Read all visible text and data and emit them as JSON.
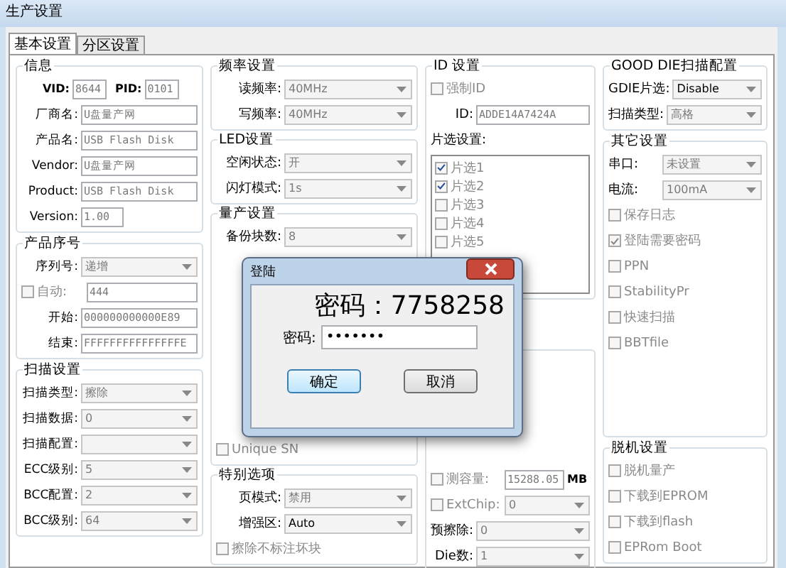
{
  "window": {
    "title": "生产设置"
  },
  "tabs": [
    {
      "label": "基本设置",
      "selected": true
    },
    {
      "label": "分区设置",
      "selected": false
    }
  ],
  "columns": [
    [
      {
        "title": "信息",
        "rows": [
          {
            "kind": "pair",
            "items": [
              {
                "label": "VID:",
                "value": "8644",
                "disabled": true
              },
              {
                "label": "PID:",
                "value": "0101",
                "disabled": true
              }
            ]
          },
          {
            "kind": "field",
            "label": "厂商名:",
            "value": "U盘量产网",
            "disabled": true
          },
          {
            "kind": "field",
            "label": "产品名:",
            "value": "USB Flash Disk",
            "disabled": true
          },
          {
            "kind": "field",
            "label": "Vendor:",
            "value": "U盘量产网",
            "disabled": true
          },
          {
            "kind": "field",
            "label": "Product:",
            "value": "USB Flash Disk",
            "disabled": true
          },
          {
            "kind": "short",
            "label": "Version:",
            "value": "1.00",
            "disabled": true
          }
        ]
      },
      {
        "title": "产品序号",
        "rows": [
          {
            "kind": "select",
            "label": "序列号:",
            "value": "递增",
            "disabled": true
          },
          {
            "kind": "checkfield",
            "label": "自动:",
            "checked": false,
            "disabled": true,
            "value": "444"
          },
          {
            "kind": "field",
            "label": "开始:",
            "value": "000000000000E89",
            "disabled": true
          },
          {
            "kind": "field",
            "label": "结束:",
            "value": "FFFFFFFFFFFFFFFE",
            "disabled": true
          }
        ]
      },
      {
        "title": "扫描设置",
        "rows": [
          {
            "kind": "select",
            "label": "扫描类型:",
            "value": "擦除",
            "disabled": true
          },
          {
            "kind": "select",
            "label": "扫描数据:",
            "value": "0",
            "disabled": true
          },
          {
            "kind": "select",
            "label": "扫描配置:"
          },
          {
            "kind": "select",
            "label": "ECC级别:",
            "value": "5",
            "disabled": true
          },
          {
            "kind": "select",
            "label": "BCC配置:",
            "value": "2",
            "disabled": true
          },
          {
            "kind": "select",
            "label": "BCC级别:",
            "value": "64",
            "disabled": true
          }
        ]
      }
    ],
    [
      {
        "title": "频率设置",
        "rows": [
          {
            "kind": "select",
            "label": "读频率:",
            "value": "40MHz",
            "disabled": true
          },
          {
            "kind": "select",
            "label": "写频率:",
            "value": "40MHz",
            "disabled": true
          }
        ]
      },
      {
        "title": "LED设置",
        "rows": [
          {
            "kind": "select",
            "label": "空闲状态:",
            "value": "开",
            "disabled": true
          },
          {
            "kind": "select",
            "label": "闪灯模式:",
            "value": "1s",
            "disabled": true
          }
        ]
      },
      {
        "title": "量产设置",
        "rows": [
          {
            "kind": "select",
            "label": "备份块数:",
            "value": "8",
            "disabled": true
          },
          {
            "kind": "check",
            "label": "Unique SN",
            "checked": false,
            "disabled": true
          }
        ]
      },
      {
        "title": "特别选项",
        "rows": [
          {
            "kind": "select",
            "label": "页模式:",
            "value": "禁用",
            "disabled": true
          },
          {
            "kind": "select",
            "label": "增强区:",
            "value": "Auto",
            "disabled": false
          },
          {
            "kind": "check",
            "label": "擦除不标注坏块",
            "checked": false,
            "disabled": true
          }
        ]
      }
    ],
    [
      {
        "title": "ID 设置",
        "rows": [
          {
            "kind": "check",
            "label": "强制ID",
            "checked": false,
            "disabled": true
          },
          {
            "kind": "field",
            "label": "ID:",
            "value": "ADDE14A7424A",
            "disabled": true
          },
          {
            "kind": "heading",
            "label": "片选设置:"
          },
          {
            "kind": "list",
            "items": [
              {
                "label": "片选1",
                "checked": true
              },
              {
                "label": "片选2",
                "checked": true
              },
              {
                "label": "片选3",
                "checked": false
              },
              {
                "label": "片选4",
                "checked": false
              },
              {
                "label": "片选5",
                "checked": false
              }
            ]
          }
        ]
      },
      {
        "rows": [
          {
            "kind": "checkfield",
            "label": "测容量:",
            "checked": false,
            "disabled": true,
            "value": "15288.05",
            "unit": "MB"
          },
          {
            "kind": "checkselect",
            "label": "ExtChip:",
            "checked": false,
            "disabled": true,
            "value": "0"
          },
          {
            "kind": "select",
            "label": "预擦除:",
            "value": "0",
            "disabled": true
          },
          {
            "kind": "select",
            "label": "Die数:",
            "value": "1",
            "disabled": true
          }
        ]
      }
    ],
    [
      {
        "title": "GOOD DIE扫描配置",
        "rows": [
          {
            "kind": "select",
            "label": "GDIE片选:",
            "value": "Disable",
            "disabled": false
          },
          {
            "kind": "select",
            "label": "扫描类型:",
            "value": "高格",
            "disabled": true
          }
        ]
      },
      {
        "title": "其它设置",
        "rows": [
          {
            "kind": "select",
            "label": "串口:",
            "value": "未设置",
            "disabled": true
          },
          {
            "kind": "select",
            "label": "电流:",
            "value": "100mA",
            "disabled": true
          },
          {
            "kind": "check",
            "label": "保存日志",
            "checked": false,
            "disabled": true
          },
          {
            "kind": "check",
            "label": "登陆需要密码",
            "checked": true,
            "disabled": true
          },
          {
            "kind": "check",
            "label": "PPN",
            "checked": false,
            "disabled": true
          },
          {
            "kind": "check",
            "label": "StabilityPr",
            "checked": false,
            "disabled": true
          },
          {
            "kind": "check",
            "label": "快速扫描",
            "checked": false,
            "disabled": true
          },
          {
            "kind": "check",
            "label": "BBTfile",
            "checked": false,
            "disabled": true
          }
        ]
      },
      {
        "title": "脱机设置",
        "rows": [
          {
            "kind": "check",
            "label": "脱机量产",
            "checked": false,
            "disabled": true
          },
          {
            "kind": "check",
            "label": "下载到EPROM",
            "checked": false,
            "disabled": true
          },
          {
            "kind": "check",
            "label": "下载到flash",
            "checked": false,
            "disabled": true
          },
          {
            "kind": "check",
            "label": "EPRom Boot",
            "checked": false,
            "disabled": true
          }
        ]
      }
    ]
  ],
  "dialog": {
    "title": "登陆",
    "banner": "密码：7758258",
    "field_label": "密码:",
    "value": "•••••••",
    "buttons": [
      {
        "label": "确定",
        "selected": true
      },
      {
        "label": "取消",
        "selected": false
      }
    ]
  }
}
